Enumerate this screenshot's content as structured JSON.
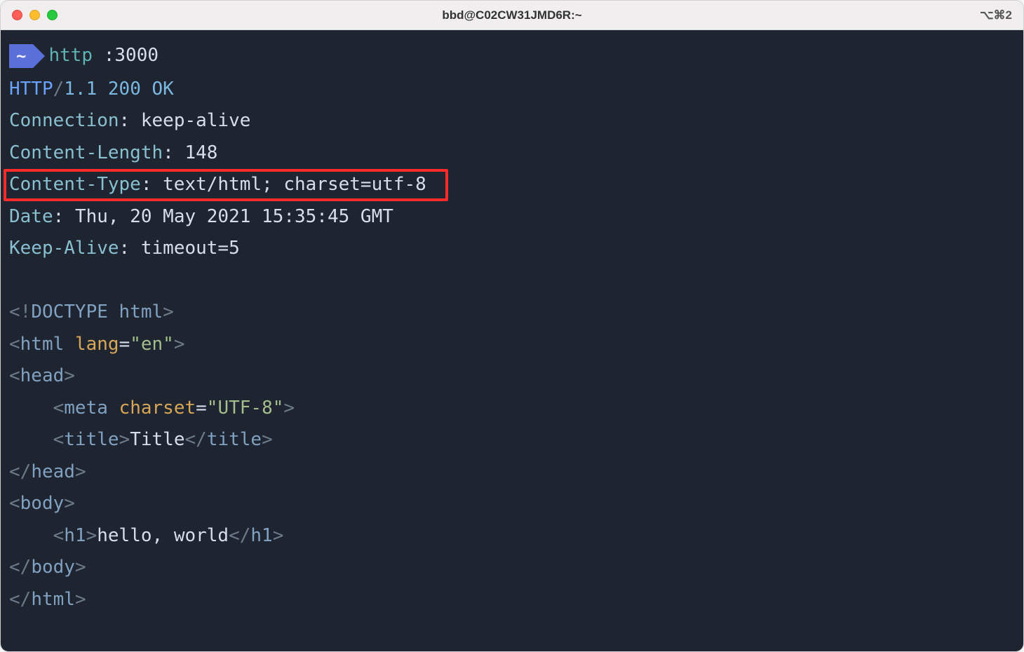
{
  "titlebar": {
    "title": "bbd@C02CW31JMD6R:~",
    "shortcut": "⌥⌘2"
  },
  "prompt": {
    "badge": "~",
    "cmd": "http",
    "arg": ":3000"
  },
  "response": {
    "proto": "HTTP",
    "slash": "/",
    "version": "1.1",
    "status": "200 OK",
    "headers": {
      "connection": {
        "k": "Connection",
        "v": "keep-alive"
      },
      "contentLength": {
        "k": "Content-Length",
        "v": "148"
      },
      "contentType": {
        "k": "Content-Type",
        "v": "text/html; charset=utf-8"
      },
      "date": {
        "k": "Date",
        "v": "Thu, 20 May 2021 15:35:45 GMT"
      },
      "keepAlive": {
        "k": "Keep-Alive",
        "v": "timeout=5"
      }
    }
  },
  "html_body": {
    "doctype_open": "<!",
    "doctype_word": "DOCTYPE",
    "doctype_rest": " html",
    "doctype_close": ">",
    "html_open_lt": "<",
    "html_tag": "html",
    "lang_attr": "lang",
    "lang_eq": "=",
    "lang_val": "\"en\"",
    "gt": ">",
    "head_tag": "head",
    "meta_tag": "meta",
    "charset_attr": "charset",
    "charset_val": "\"UTF-8\"",
    "title_tag": "title",
    "title_text": "Title",
    "body_tag": "body",
    "h1_tag": "h1",
    "h1_text": "hello, world",
    "indent": "    ",
    "close_lt": "</"
  }
}
